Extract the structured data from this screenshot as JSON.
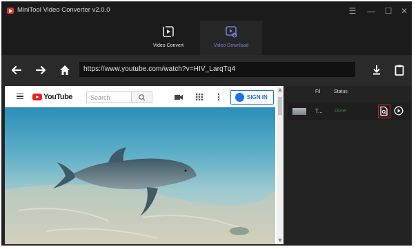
{
  "app": {
    "title": "MiniTool Video Converter v2.0.0"
  },
  "window_controls": [
    {
      "name": "menu-icon",
      "glyph": "☰"
    },
    {
      "name": "minimize-icon",
      "glyph": "—"
    },
    {
      "name": "maximize-icon",
      "glyph": "☐"
    },
    {
      "name": "close-icon",
      "glyph": "✕"
    }
  ],
  "tabs": [
    {
      "label": "Video Convert",
      "active": false
    },
    {
      "label": "Video Download",
      "active": true
    }
  ],
  "nav": {
    "url": "https://www.youtube.com/watch?v=HIV_LarqTq4",
    "back_icon": "back-arrow-icon",
    "forward_icon": "forward-arrow-icon",
    "home_icon": "home-icon",
    "download_icon": "download-icon",
    "paste_icon": "clipboard-icon"
  },
  "browser": {
    "logo_text": "YouTube",
    "search_placeholder": "Search",
    "signin_label": "SIGN IN",
    "icons": [
      "menu-icon",
      "search-icon",
      "create-video-icon",
      "apps-grid-icon",
      "more-vert-icon"
    ]
  },
  "panel": {
    "columns": [
      "Fil",
      "Status"
    ],
    "items": [
      {
        "title": "T...",
        "status": "Done",
        "status_color": "#2e8b3c"
      }
    ]
  },
  "colors": {
    "accent": "#6f7fd6",
    "highlight": "#e02020",
    "youtube_red": "#e62117",
    "signin_blue": "#1a73e8"
  }
}
